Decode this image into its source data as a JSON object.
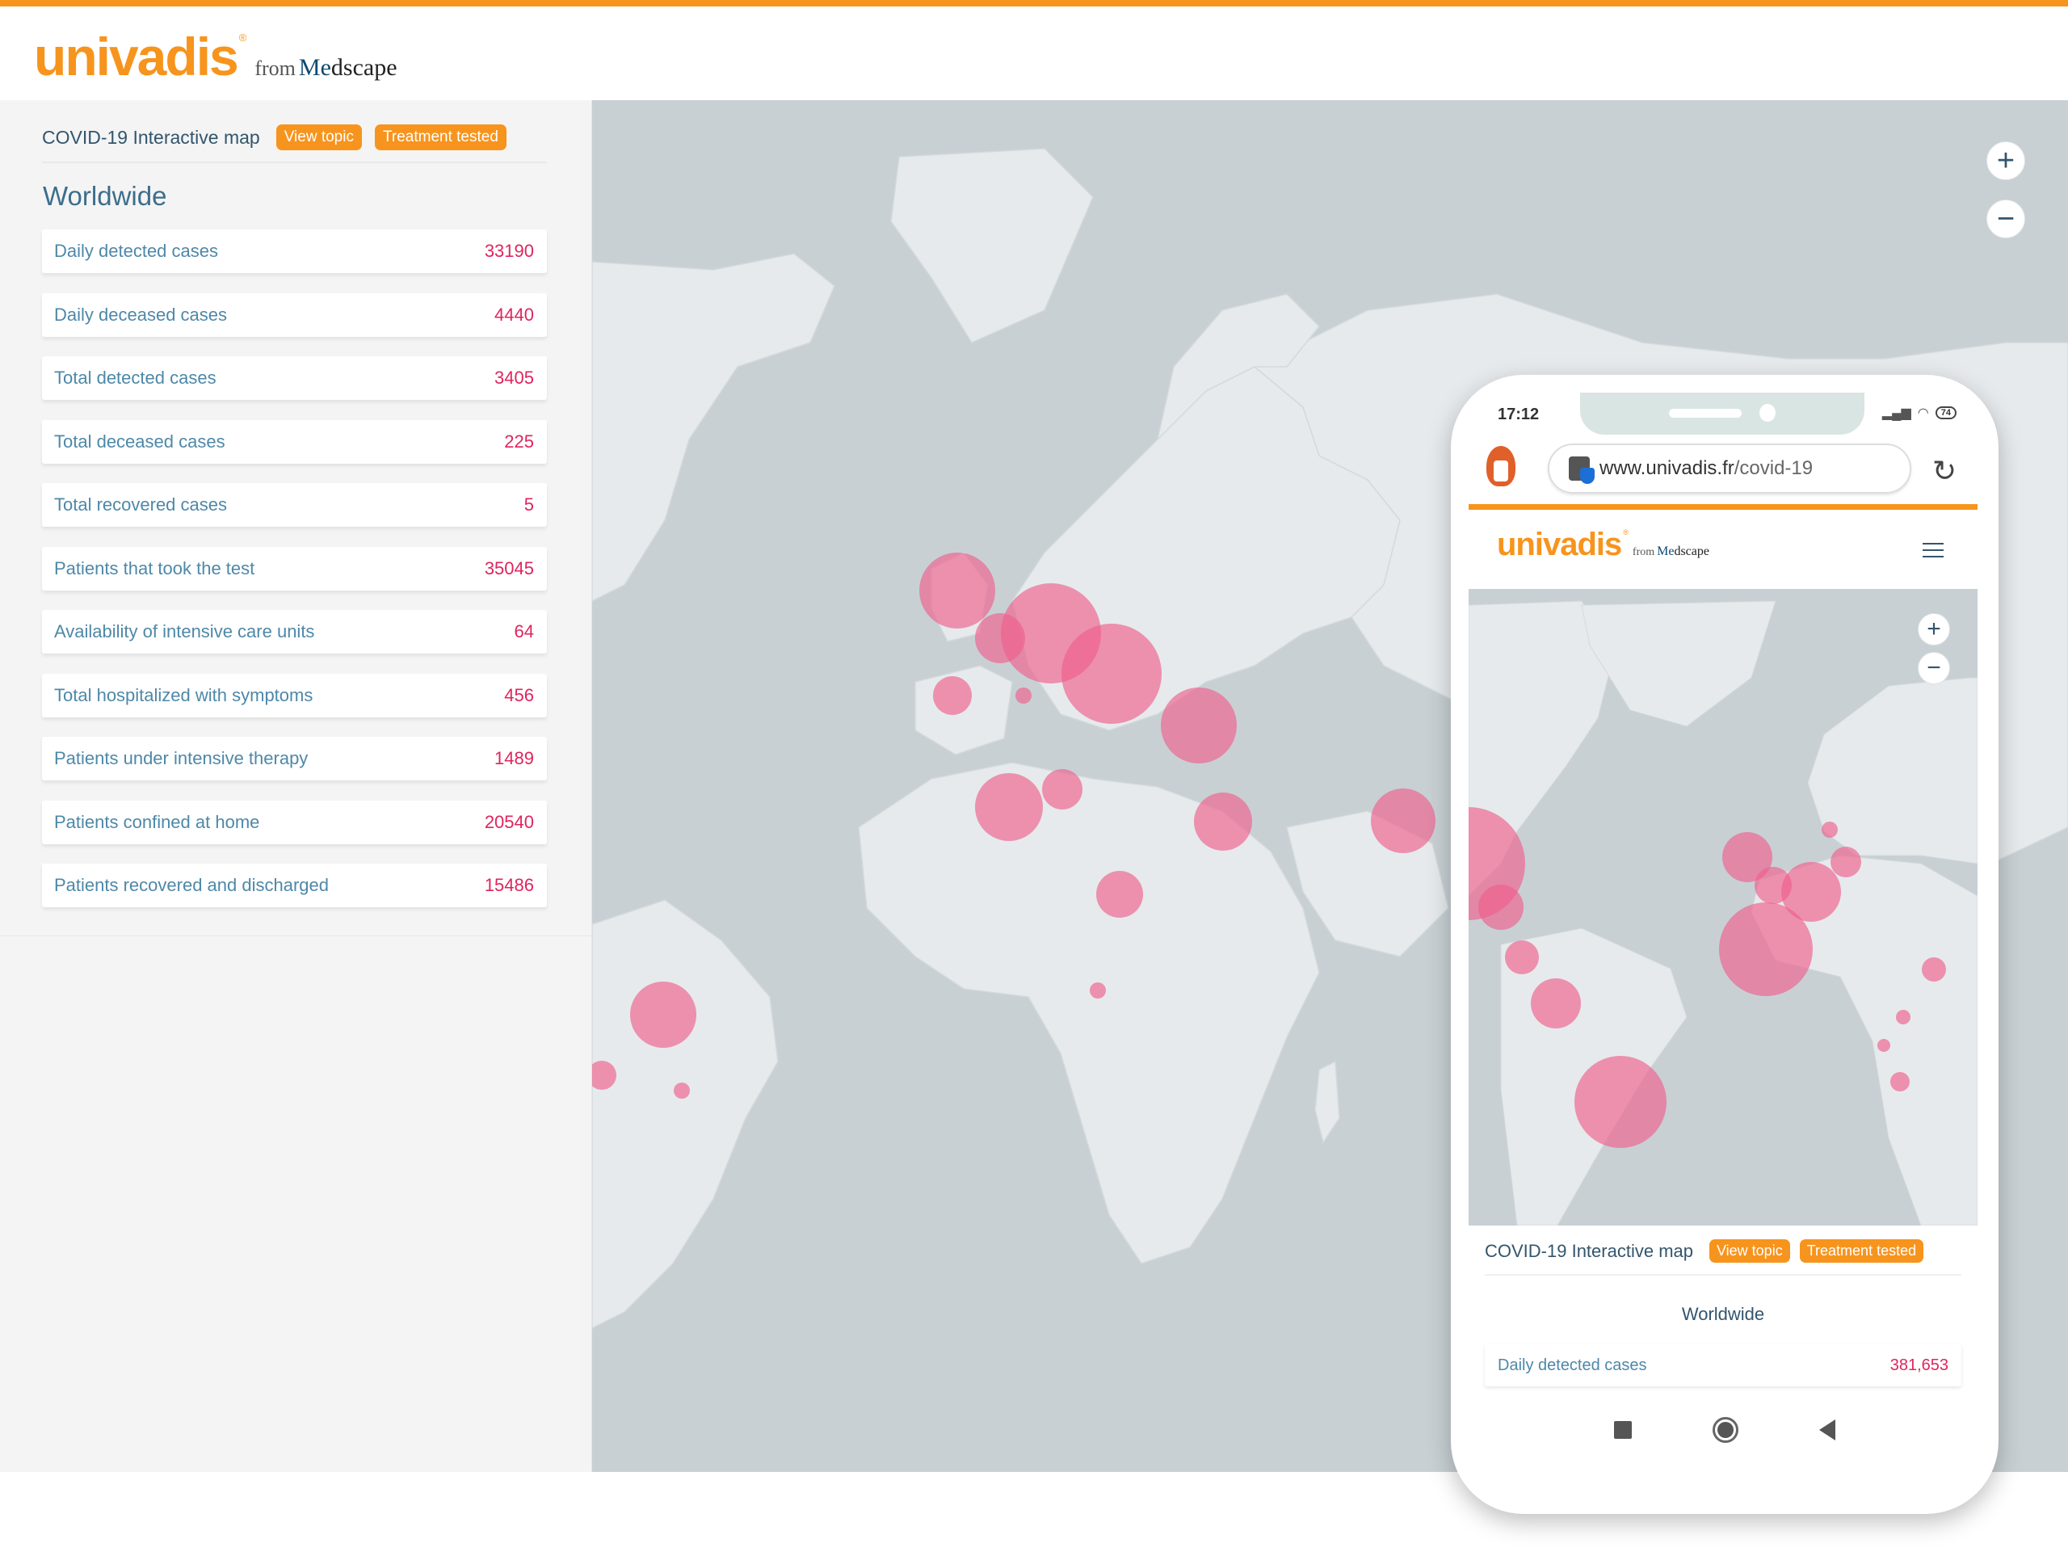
{
  "colors": {
    "accent": "#f7941d",
    "title": "#33556d",
    "label": "#4e88a8",
    "value": "#e0245e",
    "bubble": "#f0608e",
    "ocean": "#c8d0d4",
    "land": "#e6eaec"
  },
  "header": {
    "logo_main": "univadis",
    "logo_reg": "®",
    "logo_from": "from",
    "logo_med_a": "Me",
    "logo_med_b": "dscape"
  },
  "panel": {
    "title": "COVID-19 Interactive map",
    "view_topic_label": "View topic",
    "treatment_label": "Treatment tested",
    "section_heading": "Worldwide",
    "stats": [
      {
        "label": "Daily detected cases",
        "value": "33190"
      },
      {
        "label": "Daily deceased cases",
        "value": "4440"
      },
      {
        "label": "Total detected cases",
        "value": "3405"
      },
      {
        "label": "Total deceased cases",
        "value": "225"
      },
      {
        "label": "Total recovered cases",
        "value": "5"
      },
      {
        "label": "Patients that took the test",
        "value": "35045"
      },
      {
        "label": "Availability of intensive care units",
        "value": "64"
      },
      {
        "label": "Total  hospitalized with symptoms",
        "value": "456"
      },
      {
        "label": "Patients under intensive therapy",
        "value": "1489"
      },
      {
        "label": "Patients confined at home",
        "value": "20540"
      },
      {
        "label": "Patients recovered and discharged",
        "value": "15486"
      }
    ]
  },
  "map": {
    "zoom_in_label": "+",
    "zoom_out_label": "−",
    "bubbles_regions": [
      "United Kingdom",
      "France",
      "Central Europe",
      "Balkans",
      "Spain",
      "Sardinia",
      "Turkey / Levant",
      "Algeria",
      "Libya",
      "Arabian Peninsula",
      "Central Africa",
      "Congo",
      "India",
      "Brazil",
      "Peru",
      "Bolivia"
    ]
  },
  "phone": {
    "status_time": "17:12",
    "battery": "74",
    "url_host": "www.univadis.fr",
    "url_path": "/covid-19",
    "reload_icon": "↻",
    "title": "COVID-19 Interactive map",
    "view_topic_label": "View topic",
    "treatment_label": "Treatment tested",
    "section_heading": "Worldwide",
    "stat": {
      "label": "Daily detected cases",
      "value": "381,653"
    },
    "zoom_in_label": "+",
    "zoom_out_label": "−"
  }
}
